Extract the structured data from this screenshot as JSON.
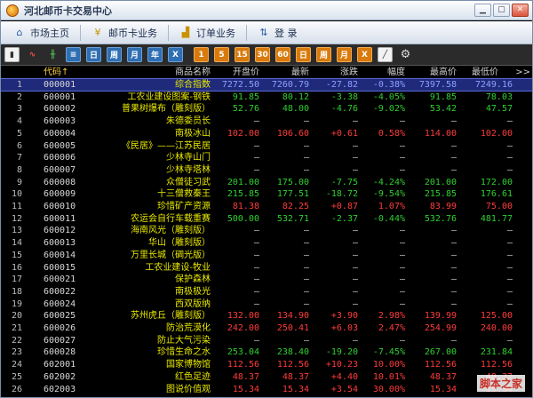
{
  "window": {
    "title": "河北邮币卡交易中心"
  },
  "menu": [
    {
      "label": "市场主页",
      "icon": "home-icon"
    },
    {
      "label": "邮币卡业务",
      "icon": "yen-icon"
    },
    {
      "label": "订单业务",
      "icon": "chart-icon"
    },
    {
      "label": "登  录",
      "icon": "login-icon"
    }
  ],
  "toolbar": [
    {
      "icon": "bar-chart-icon",
      "glyph": "▮",
      "style": "active"
    },
    {
      "icon": "line-chart-icon",
      "glyph": "∿",
      "style": "tb-red"
    },
    {
      "icon": "kline-icon",
      "glyph": "╫",
      "style": "tb-green"
    },
    {
      "icon": "list-icon",
      "glyph": "≡",
      "style": "tb-blue"
    },
    {
      "icon": "day-icon",
      "glyph": "日",
      "style": "tb-blue"
    },
    {
      "icon": "week-icon",
      "glyph": "周",
      "style": "tb-blue"
    },
    {
      "icon": "month-icon",
      "glyph": "月",
      "style": "tb-blue"
    },
    {
      "icon": "year-icon",
      "glyph": "年",
      "style": "tb-blue"
    },
    {
      "icon": "x-icon",
      "glyph": "X",
      "style": "tb-blue"
    },
    {
      "icon": "min1-icon",
      "glyph": "1",
      "style": "tb-orange"
    },
    {
      "icon": "min5-icon",
      "glyph": "5",
      "style": "tb-orange"
    },
    {
      "icon": "min15-icon",
      "glyph": "15",
      "style": "tb-orange"
    },
    {
      "icon": "min30-icon",
      "glyph": "30",
      "style": "tb-orange"
    },
    {
      "icon": "min60-icon",
      "glyph": "60",
      "style": "tb-orange"
    },
    {
      "icon": "day-k-icon",
      "glyph": "日",
      "style": "tb-orange"
    },
    {
      "icon": "week-k-icon",
      "glyph": "周",
      "style": "tb-orange"
    },
    {
      "icon": "month-k-icon",
      "glyph": "月",
      "style": "tb-orange"
    },
    {
      "icon": "x2-icon",
      "glyph": "X",
      "style": "tb-orange"
    },
    {
      "icon": "draw-icon",
      "glyph": "╱",
      "style": "active"
    },
    {
      "icon": "gear-icon",
      "glyph": "⚙",
      "style": "tb-gear"
    }
  ],
  "table": {
    "headers": {
      "code": "代码↑",
      "name": "商品名称",
      "open": "开盘价",
      "last": "最新",
      "change": "涨跌",
      "pct": "幅度",
      "high": "最高价",
      "low": "最低价",
      "more": ">>"
    },
    "rows": [
      {
        "idx": "1",
        "code": "000001",
        "name": "综合指数",
        "open": "7272.50",
        "last": "7260.79",
        "change": "-27.82",
        "pct": "-0.38%",
        "high": "7397.58",
        "low": "7249.16",
        "dir": "down"
      },
      {
        "idx": "2",
        "code": "600001",
        "name": "工农业建设图案-钢铁",
        "open": "91.85",
        "last": "80.12",
        "change": "-3.38",
        "pct": "-4.05%",
        "high": "91.85",
        "low": "78.03",
        "dir": "down"
      },
      {
        "idx": "3",
        "code": "600002",
        "name": "普果树爆布（雕刻版）",
        "open": "52.76",
        "last": "48.00",
        "change": "-4.76",
        "pct": "-9.02%",
        "high": "53.42",
        "low": "47.57",
        "dir": "down"
      },
      {
        "idx": "4",
        "code": "600003",
        "name": "朱德委员长",
        "open": "—",
        "last": "—",
        "change": "—",
        "pct": "—",
        "high": "—",
        "low": "—",
        "dir": "none"
      },
      {
        "idx": "5",
        "code": "600004",
        "name": "南极冰山",
        "open": "102.00",
        "last": "106.60",
        "change": "+0.61",
        "pct": "0.58%",
        "high": "114.00",
        "low": "102.00",
        "dir": "up"
      },
      {
        "idx": "6",
        "code": "600005",
        "name": "《民居》——江苏民居",
        "open": "—",
        "last": "—",
        "change": "—",
        "pct": "—",
        "high": "—",
        "low": "—",
        "dir": "none"
      },
      {
        "idx": "7",
        "code": "600006",
        "name": "少林寺山门",
        "open": "—",
        "last": "—",
        "change": "—",
        "pct": "—",
        "high": "—",
        "low": "—",
        "dir": "none"
      },
      {
        "idx": "8",
        "code": "600007",
        "name": "少林寺塔林",
        "open": "—",
        "last": "—",
        "change": "—",
        "pct": "—",
        "high": "—",
        "low": "—",
        "dir": "none"
      },
      {
        "idx": "9",
        "code": "600008",
        "name": "众僧徒习武",
        "open": "201.00",
        "last": "175.00",
        "change": "-7.75",
        "pct": "-4.24%",
        "high": "201.00",
        "low": "172.00",
        "dir": "down"
      },
      {
        "idx": "10",
        "code": "600009",
        "name": "十三僧救秦王",
        "open": "215.85",
        "last": "177.51",
        "change": "-18.72",
        "pct": "-9.54%",
        "high": "215.85",
        "low": "176.61",
        "dir": "down"
      },
      {
        "idx": "11",
        "code": "600010",
        "name": "珍惜矿产资源",
        "open": "81.38",
        "last": "82.25",
        "change": "+0.87",
        "pct": "1.07%",
        "high": "83.99",
        "low": "75.00",
        "dir": "up"
      },
      {
        "idx": "12",
        "code": "600011",
        "name": "农运会自行车载重赛",
        "open": "500.00",
        "last": "532.71",
        "change": "-2.37",
        "pct": "-0.44%",
        "high": "532.76",
        "low": "481.77",
        "dir": "down"
      },
      {
        "idx": "13",
        "code": "600012",
        "name": "海南风光（雕刻版）",
        "open": "—",
        "last": "—",
        "change": "—",
        "pct": "—",
        "high": "—",
        "low": "—",
        "dir": "none"
      },
      {
        "idx": "14",
        "code": "600013",
        "name": "华山（雕刻版）",
        "open": "—",
        "last": "—",
        "change": "—",
        "pct": "—",
        "high": "—",
        "low": "—",
        "dir": "none"
      },
      {
        "idx": "15",
        "code": "600014",
        "name": "万里长城（碉光版）",
        "open": "—",
        "last": "—",
        "change": "—",
        "pct": "—",
        "high": "—",
        "low": "—",
        "dir": "none"
      },
      {
        "idx": "16",
        "code": "600015",
        "name": "工农业建设-牧业",
        "open": "—",
        "last": "—",
        "change": "—",
        "pct": "—",
        "high": "—",
        "low": "—",
        "dir": "none"
      },
      {
        "idx": "17",
        "code": "600021",
        "name": "保护森林",
        "open": "—",
        "last": "—",
        "change": "—",
        "pct": "—",
        "high": "—",
        "low": "—",
        "dir": "none"
      },
      {
        "idx": "18",
        "code": "600022",
        "name": "南极极光",
        "open": "—",
        "last": "—",
        "change": "—",
        "pct": "—",
        "high": "—",
        "low": "—",
        "dir": "none"
      },
      {
        "idx": "19",
        "code": "600024",
        "name": "西双版纳",
        "open": "—",
        "last": "—",
        "change": "—",
        "pct": "—",
        "high": "—",
        "low": "—",
        "dir": "none"
      },
      {
        "idx": "20",
        "code": "600025",
        "name": "苏州虎丘（雕刻版）",
        "open": "132.00",
        "last": "134.90",
        "change": "+3.90",
        "pct": "2.98%",
        "high": "139.99",
        "low": "125.00",
        "dir": "up"
      },
      {
        "idx": "21",
        "code": "600026",
        "name": "防治荒漠化",
        "open": "242.00",
        "last": "250.41",
        "change": "+6.03",
        "pct": "2.47%",
        "high": "254.99",
        "low": "240.00",
        "dir": "up"
      },
      {
        "idx": "22",
        "code": "600027",
        "name": "防止大气污染",
        "open": "—",
        "last": "—",
        "change": "—",
        "pct": "—",
        "high": "—",
        "low": "—",
        "dir": "none"
      },
      {
        "idx": "23",
        "code": "600028",
        "name": "珍惜生命之水",
        "open": "253.04",
        "last": "238.40",
        "change": "-19.20",
        "pct": "-7.45%",
        "high": "267.00",
        "low": "231.84",
        "dir": "down"
      },
      {
        "idx": "24",
        "code": "602001",
        "name": "国家博物馆",
        "open": "112.56",
        "last": "112.56",
        "change": "+10.23",
        "pct": "10.00%",
        "high": "112.56",
        "low": "112.56",
        "dir": "up"
      },
      {
        "idx": "25",
        "code": "602002",
        "name": "红色足迹",
        "open": "48.37",
        "last": "48.37",
        "change": "+4.40",
        "pct": "10.01%",
        "high": "48.37",
        "low": "48.37",
        "dir": "up"
      },
      {
        "idx": "26",
        "code": "602003",
        "name": "图说价值观",
        "open": "15.34",
        "last": "15.34",
        "change": "+3.54",
        "pct": "30.00%",
        "high": "15.34",
        "low": "15.34",
        "dir": "up"
      }
    ]
  },
  "watermark": "脚本之家"
}
